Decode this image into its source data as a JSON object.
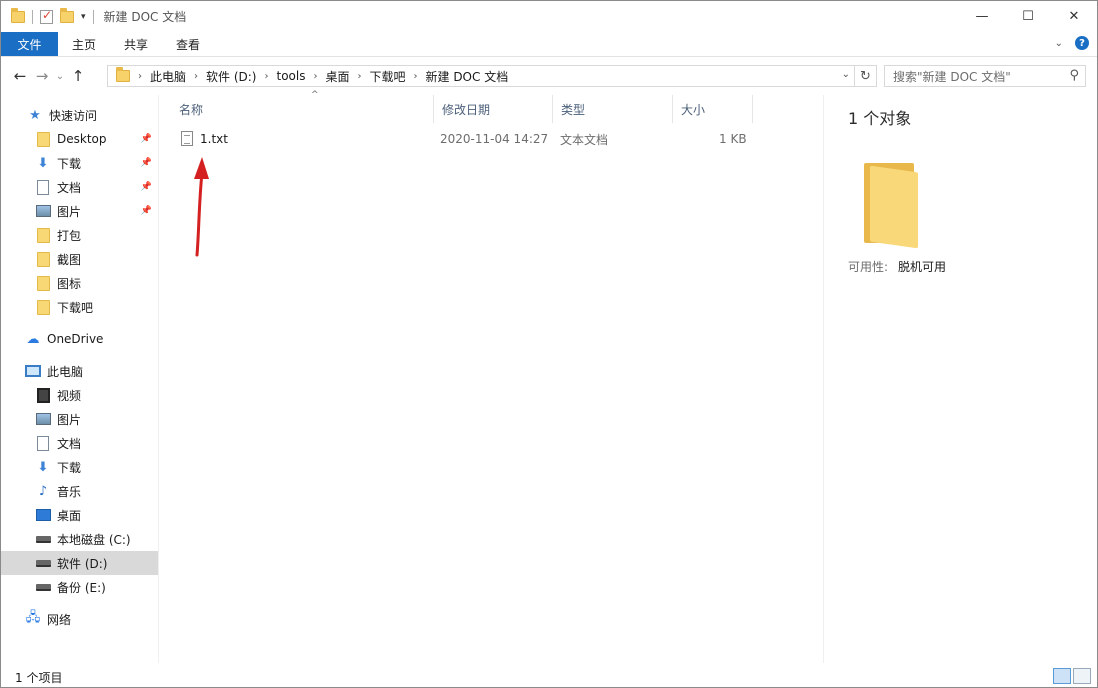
{
  "window": {
    "title": "新建 DOC 文档",
    "controls": {
      "minimize": "—",
      "maximize": "☐",
      "close": "✕"
    }
  },
  "quick_access_toolbar": {
    "dropdown_glyph": "▾"
  },
  "ribbon": {
    "tabs": [
      "文件",
      "主页",
      "共享",
      "查看"
    ],
    "expand_glyph": "⌄",
    "help_glyph": "?"
  },
  "nav": {
    "back_glyph": "←",
    "forward_glyph": "→",
    "recent_glyph": "⌄",
    "up_glyph": "↑",
    "breadcrumbs": [
      "此电脑",
      "软件 (D:)",
      "tools",
      "桌面",
      "下载吧",
      "新建 DOC 文档"
    ],
    "crumb_separator": "›",
    "dropdown_glyph": "⌄",
    "refresh_glyph": "↻"
  },
  "search": {
    "placeholder": "搜索\"新建 DOC 文档\"",
    "icon_glyph": "⚲"
  },
  "sidebar": {
    "pin_glyph": "📌",
    "quick_access_label": "快速访问",
    "quick_access_items": [
      {
        "label": "Desktop",
        "icon": "folder-icon",
        "pinned": true
      },
      {
        "label": "下载",
        "icon": "download-icon",
        "pinned": true
      },
      {
        "label": "文档",
        "icon": "document-icon",
        "pinned": true
      },
      {
        "label": "图片",
        "icon": "pictures-icon",
        "pinned": true
      },
      {
        "label": "打包",
        "icon": "folder-icon",
        "pinned": false
      },
      {
        "label": "截图",
        "icon": "folder-icon",
        "pinned": false
      },
      {
        "label": "图标",
        "icon": "folder-icon",
        "pinned": false
      },
      {
        "label": "下载吧",
        "icon": "folder-icon",
        "pinned": false
      }
    ],
    "onedrive_label": "OneDrive",
    "this_pc_label": "此电脑",
    "this_pc_items": [
      {
        "label": "视频",
        "icon": "video-icon"
      },
      {
        "label": "图片",
        "icon": "pictures-icon"
      },
      {
        "label": "文档",
        "icon": "document-icon"
      },
      {
        "label": "下载",
        "icon": "download-icon"
      },
      {
        "label": "音乐",
        "icon": "music-icon"
      },
      {
        "label": "桌面",
        "icon": "desktop-icon"
      },
      {
        "label": "本地磁盘 (C:)",
        "icon": "drive-icon"
      },
      {
        "label": "软件 (D:)",
        "icon": "drive-icon",
        "selected": true
      },
      {
        "label": "备份 (E:)",
        "icon": "drive-icon"
      }
    ],
    "network_label": "网络"
  },
  "file_list": {
    "sort_glyph": "^",
    "columns": [
      "名称",
      "修改日期",
      "类型",
      "大小"
    ],
    "rows": [
      {
        "name": "1.txt",
        "modified": "2020-11-04 14:27",
        "type": "文本文档",
        "size": "1 KB"
      }
    ]
  },
  "details_pane": {
    "count": "1 个对象",
    "availability_label": "可用性:",
    "availability_value": "脱机可用"
  },
  "status_bar": {
    "item_count": "1 个项目"
  },
  "colors": {
    "accent": "#1a6fc4",
    "selection": "#d9d9d9",
    "annotation_arrow": "#d42020"
  }
}
